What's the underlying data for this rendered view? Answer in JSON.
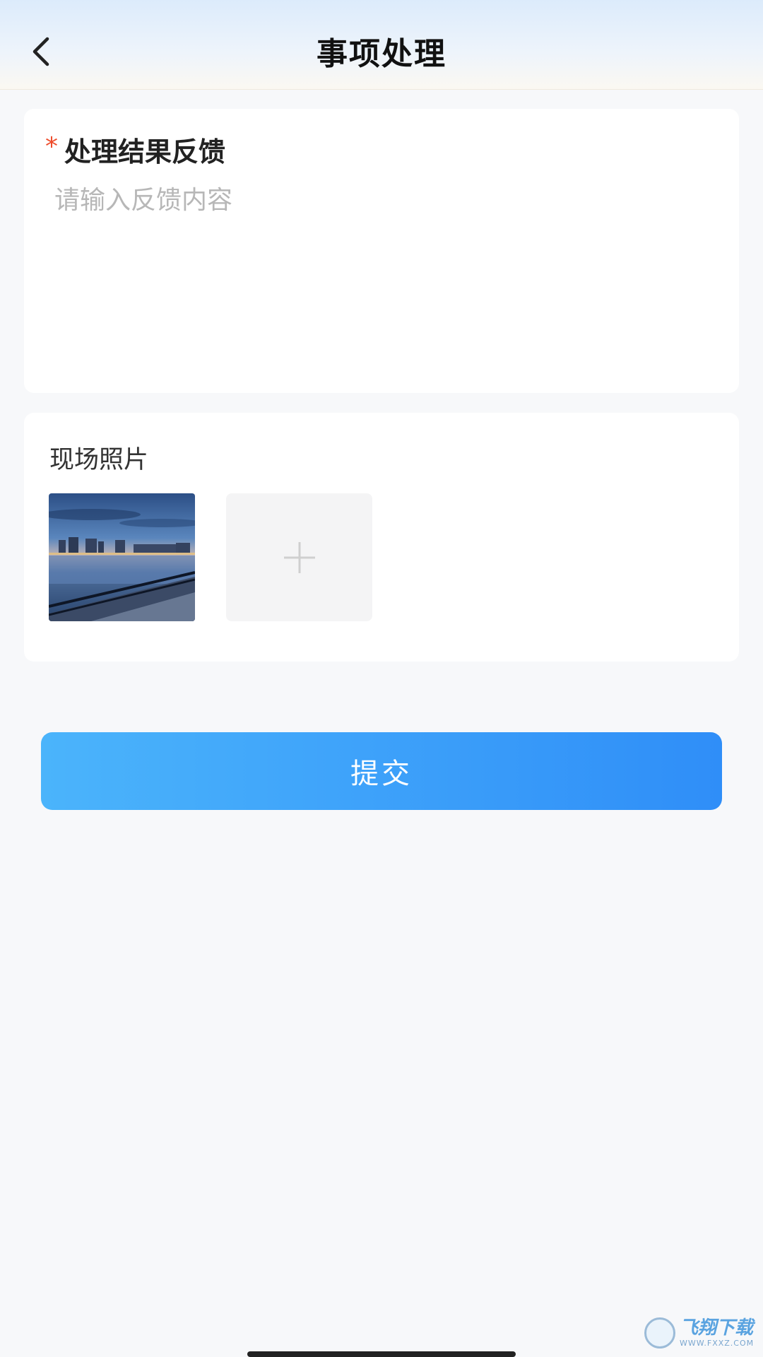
{
  "header": {
    "title": "事项处理",
    "back_icon": "chevron-left-icon"
  },
  "feedback": {
    "required_mark": "*",
    "label": "处理结果反馈",
    "value": "",
    "placeholder": "请输入反馈内容"
  },
  "photos": {
    "label": "现场照片",
    "add_icon": "plus-icon"
  },
  "submit": {
    "label": "提交"
  },
  "watermark": {
    "name": "飞翔下载",
    "url": "WWW.FXXZ.COM"
  },
  "colors": {
    "accent_start": "#4bb4fb",
    "accent_end": "#2f8ef8",
    "required": "#ee4d2d",
    "placeholder": "#b7b7b7"
  }
}
